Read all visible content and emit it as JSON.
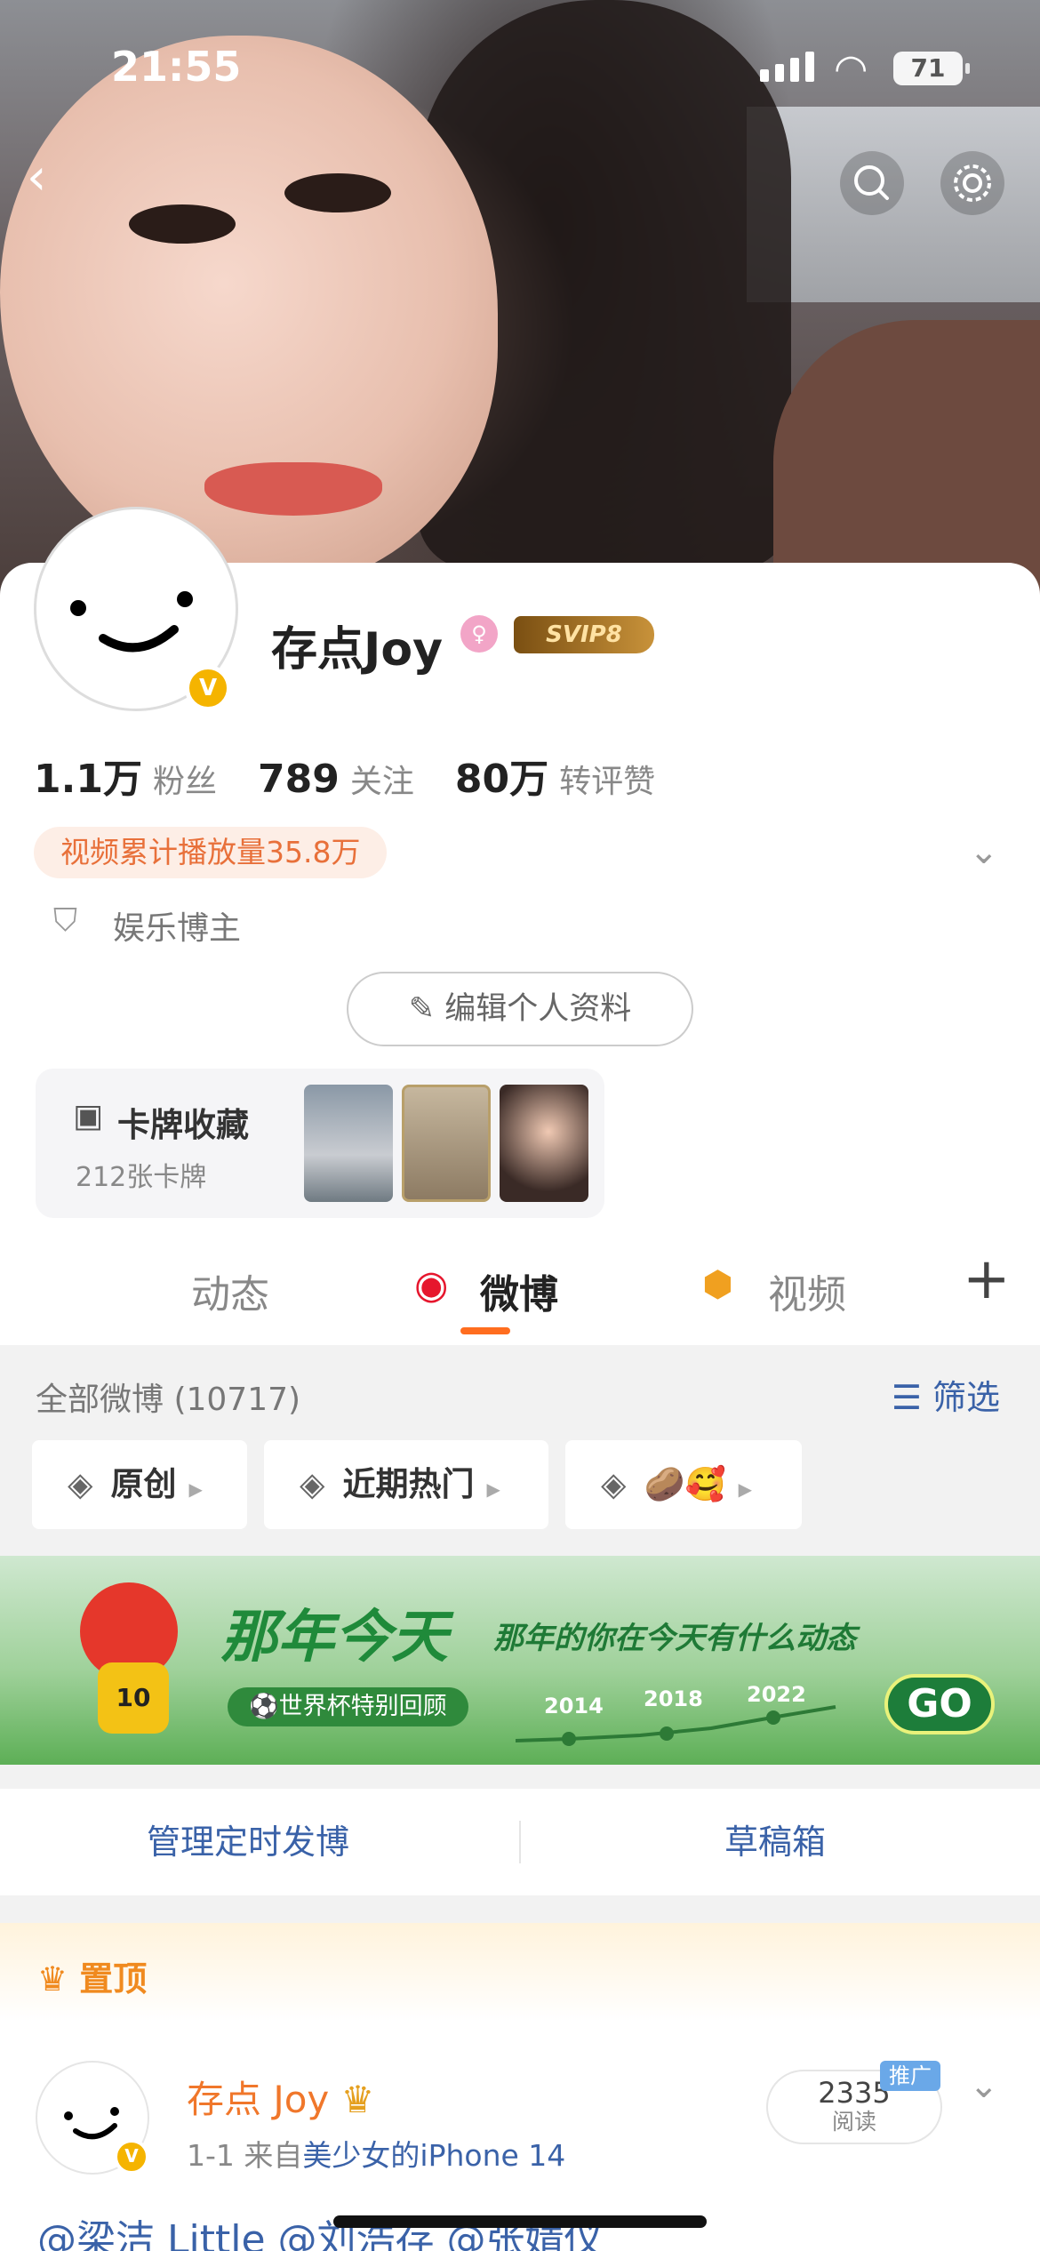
{
  "status_bar": {
    "time": "21:55",
    "battery": "71"
  },
  "profile": {
    "name": "存点Joy",
    "vip_badge": "SVIP8",
    "stats": [
      {
        "value": "1.1万",
        "label": "粉丝"
      },
      {
        "value": "789",
        "label": "关注"
      },
      {
        "value": "80万",
        "label": "转评赞"
      }
    ],
    "video_pill": "视频累计播放量35.8万",
    "tag": "娱乐博主",
    "edit_button": "编辑个人资料",
    "card_collection": {
      "title": "卡牌收藏",
      "count": "212张卡牌"
    }
  },
  "tabs": [
    {
      "label": "动态"
    },
    {
      "label": "微博"
    },
    {
      "label": "视频"
    }
  ],
  "feed": {
    "all_weibo": "全部微博 (10717)",
    "filter": "筛选",
    "chips": [
      "原创",
      "近期热门",
      "🥔🥰"
    ]
  },
  "banner": {
    "title": "那年今天",
    "subtitle": "那年的你在今天有什么动态",
    "worldcup": "⚽世界杯特别回顾",
    "years": [
      "2014",
      "2018",
      "2022"
    ],
    "go": "GO",
    "mascot_number": "10"
  },
  "actions": {
    "scheduled": "管理定时发博",
    "drafts": "草稿箱"
  },
  "post": {
    "pinned": "置顶",
    "author": "存点 Joy",
    "date": "1-1",
    "source_prefix": "来自",
    "device": "美少女的iPhone 14",
    "read_count": "2335",
    "read_label": "阅读",
    "promo": "推广",
    "text": "@梁洁 Little @刘浩存 @张婧仪"
  },
  "colors": {
    "accent": "#ff6d1f",
    "link": "#3a62a8",
    "pill_text": "#e8703a"
  }
}
